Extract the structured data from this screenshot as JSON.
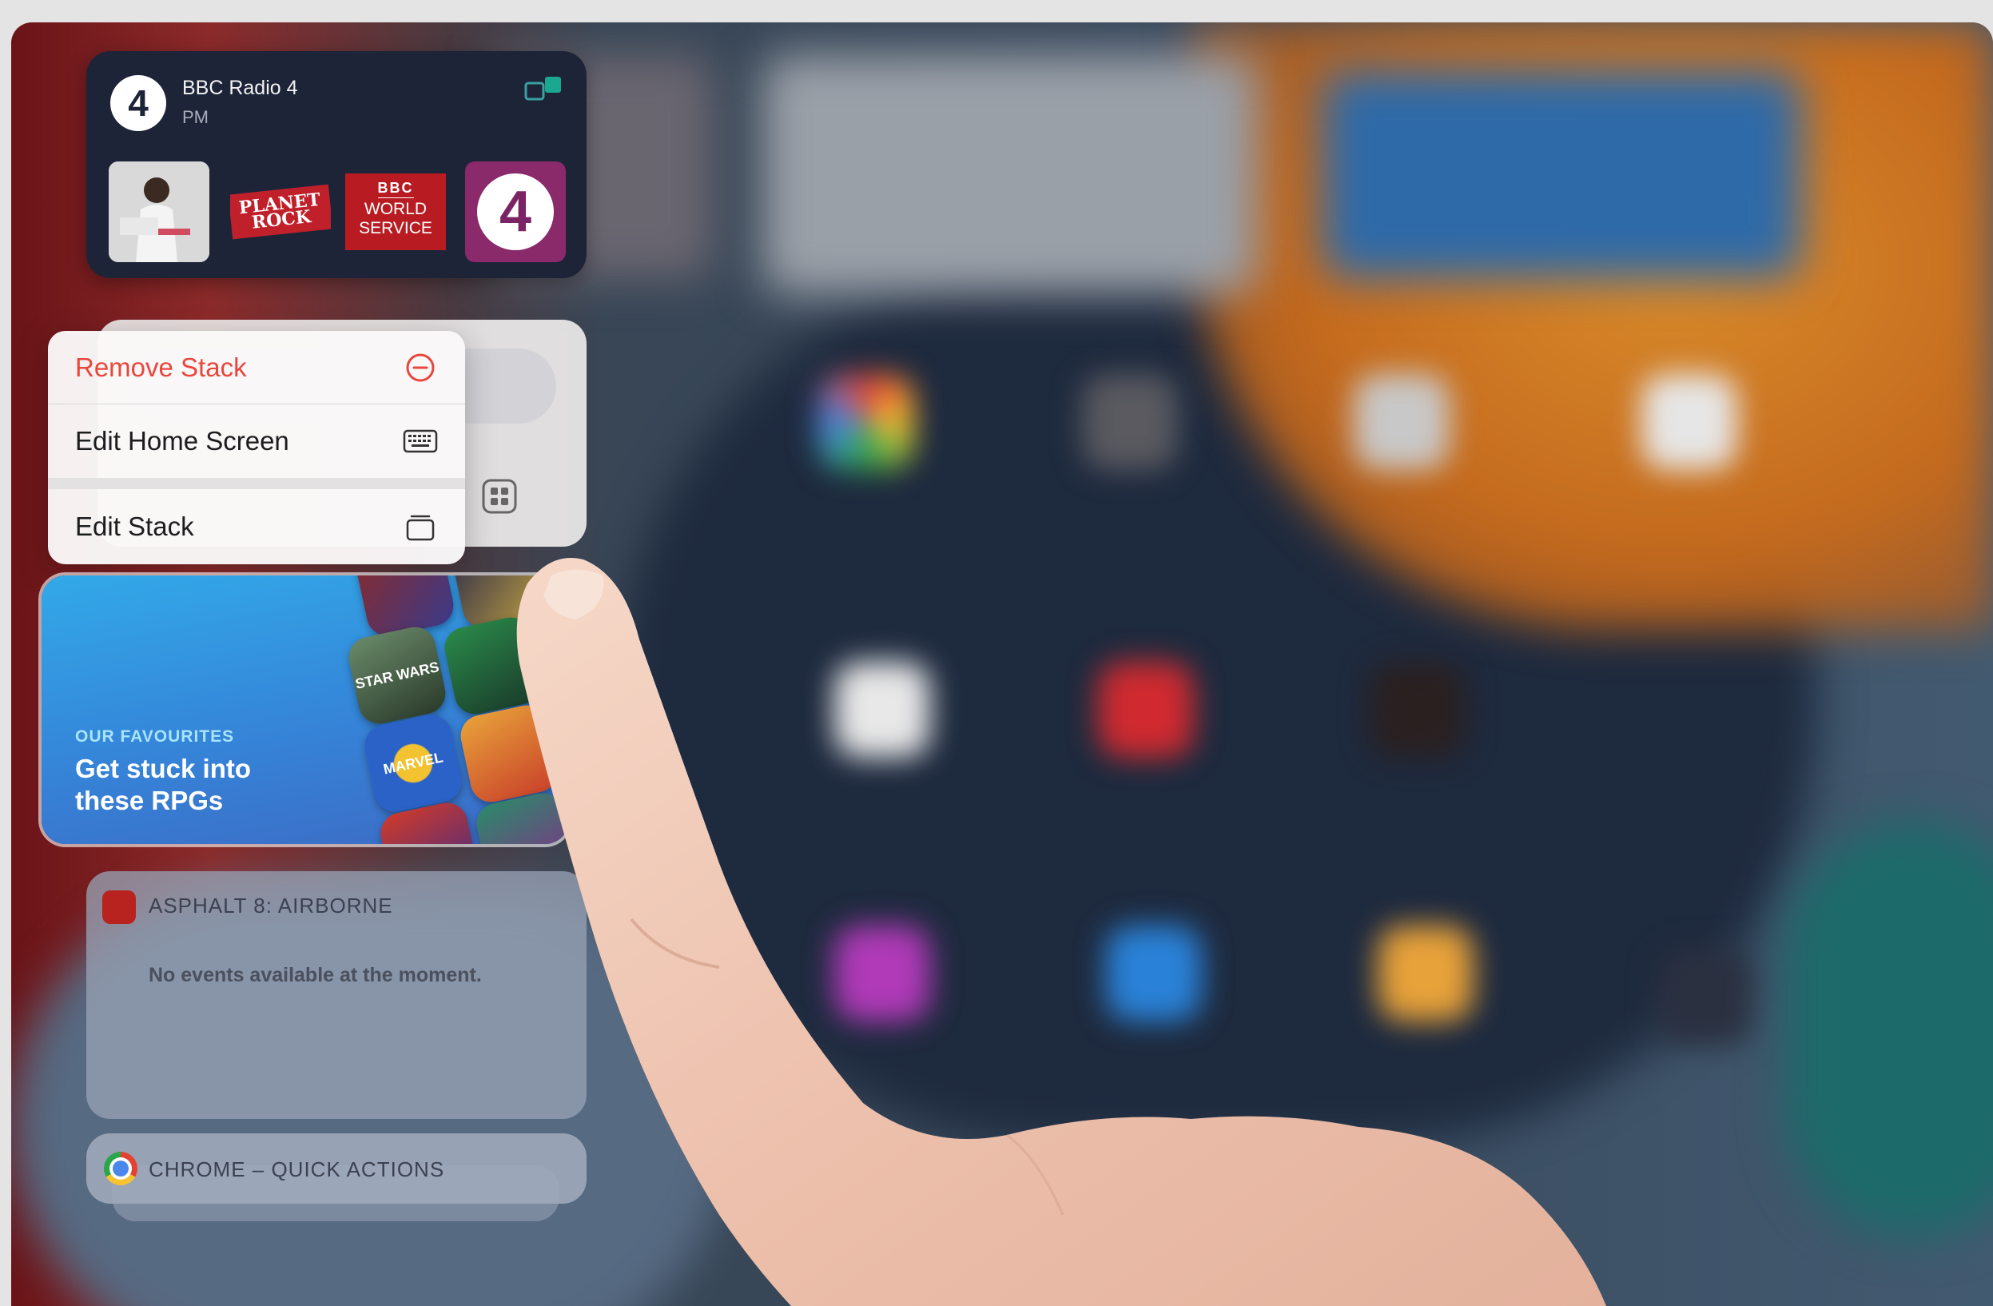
{
  "radio_widget": {
    "station": "BBC Radio 4",
    "programme": "PM",
    "logo_number": "4",
    "thumbnails": [
      {
        "name": "artist-thumbnail"
      },
      {
        "label": "PLANET ROCK"
      },
      {
        "label_top": "BBC",
        "label": "WORLD SERVICE"
      },
      {
        "label": "4"
      }
    ]
  },
  "context_menu": {
    "items": [
      {
        "label": "Remove Stack",
        "icon": "minus-circle-icon",
        "destructive": true
      },
      {
        "label": "Edit Home Screen",
        "icon": "keyboard-icon"
      },
      {
        "label": "Edit Stack",
        "icon": "stack-icon"
      }
    ]
  },
  "rpg_widget": {
    "kicker": "OUR FAVOURITES",
    "title": "Get stuck into these RPGs",
    "tiles": [
      {
        "label": ""
      },
      {
        "label": ""
      },
      {
        "label": "STAR WARS"
      },
      {
        "label": ""
      },
      {
        "label": "MARVEL"
      },
      {
        "label": ""
      },
      {
        "label": ""
      },
      {
        "label": ""
      }
    ]
  },
  "asphalt_widget": {
    "title": "ASPHALT 8: AIRBORNE",
    "message": "No events available at the moment."
  },
  "chrome_widget": {
    "title": "CHROME – QUICK ACTIONS"
  },
  "colors": {
    "destructive": "#e9463c",
    "radio_bg": "#1d2438",
    "rpg_gradient_start": "#32a9e8",
    "rpg_gradient_end": "#3d6ac4"
  }
}
